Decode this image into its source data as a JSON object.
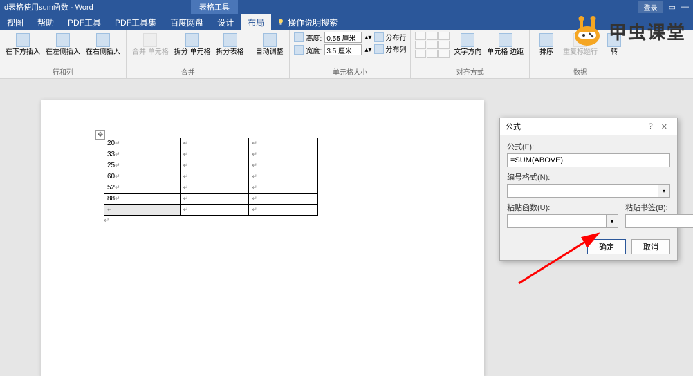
{
  "title_bar": {
    "title": "d表格使用sum函数 - Word",
    "login": "登录"
  },
  "tool_context": "表格工具",
  "tabs": {
    "items": [
      "视图",
      "帮助",
      "PDF工具",
      "PDF工具集",
      "百度网盘",
      "设计",
      "布局"
    ],
    "active_index": 6,
    "tell_me": "操作说明搜索"
  },
  "ribbon": {
    "rows_cols": {
      "label": "行和列",
      "insert_below": "在下方插入",
      "insert_left": "在左侧插入",
      "insert_right": "在右侧插入"
    },
    "merge": {
      "label": "合并",
      "merge_cells": "合并\n单元格",
      "split_cells": "拆分\n单元格",
      "split_table": "拆分表格"
    },
    "autofit": "自动调整",
    "cell_size": {
      "label": "单元格大小",
      "height_label": "高度:",
      "height_val": "0.55 厘米",
      "width_label": "宽度:",
      "width_val": "3.5 厘米",
      "dist_rows": "分布行",
      "dist_cols": "分布列"
    },
    "alignment": {
      "label": "对齐方式",
      "text_dir": "文字方向",
      "cell_margins": "单元格\n边距"
    },
    "data": {
      "label": "数据",
      "sort": "排序",
      "repeat_header": "重复标题行",
      "convert": "转"
    }
  },
  "table": {
    "rows": [
      {
        "c1": "20",
        "c2": "",
        "c3": ""
      },
      {
        "c1": "33",
        "c2": "",
        "c3": ""
      },
      {
        "c1": "25",
        "c2": "",
        "c3": ""
      },
      {
        "c1": "60",
        "c2": "",
        "c3": ""
      },
      {
        "c1": "52",
        "c2": "",
        "c3": ""
      },
      {
        "c1": "88",
        "c2": "",
        "c3": ""
      },
      {
        "c1": "",
        "c2": "",
        "c3": "",
        "active": true
      }
    ]
  },
  "dialog": {
    "title": "公式",
    "formula_label": "公式(F):",
    "formula_value": "=SUM(ABOVE)",
    "format_label": "编号格式(N):",
    "paste_func_label": "粘贴函数(U):",
    "paste_bookmark_label": "粘贴书签(B):",
    "ok": "确定",
    "cancel": "取消"
  },
  "watermark": "甲虫课堂"
}
